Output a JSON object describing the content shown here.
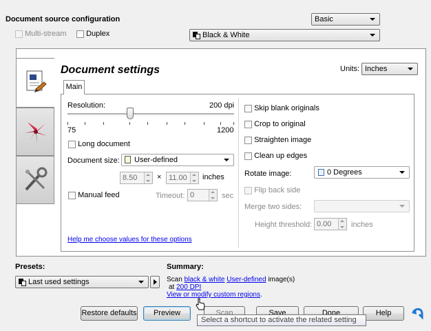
{
  "header": {
    "title": "Document source configuration",
    "mode_select": "Basic",
    "multistream_label": "Multi-stream",
    "duplex_label": "Duplex",
    "color_mode_select": "Black & White"
  },
  "panel": {
    "title": "Document settings",
    "units_label": "Units:",
    "units_select": "Inches",
    "tab_main": "Main",
    "resolution_label": "Resolution:",
    "resolution_value": "200 dpi",
    "slider_min": "75",
    "slider_max": "1200",
    "slider_level_dpi": 200,
    "long_document_label": "Long document",
    "document_size_label": "Document size:",
    "document_size_select": "User-defined",
    "width_value": "8.50",
    "times": "×",
    "height_value": "11.00",
    "size_unit": "inches",
    "manual_feed_label": "Manual feed",
    "timeout_label": "Timeout:",
    "timeout_value": "0",
    "timeout_unit": "sec",
    "help_link": "Help me choose values for these options",
    "skip_blank_label": "Skip blank originals",
    "crop_label": "Crop to original",
    "straighten_label": "Straighten image",
    "clean_edges_label": "Clean up edges",
    "rotate_label": "Rotate image:",
    "rotate_select": "0 Degrees",
    "flip_back_label": "Flip back side",
    "merge_label": "Merge two sides:",
    "merge_select": "",
    "height_threshold_label": "Height threshold:",
    "height_threshold_value": "0.00",
    "height_threshold_unit": "inches"
  },
  "presets": {
    "label": "Presets:",
    "select": "Last used settings"
  },
  "summary": {
    "label": "Summary:",
    "scan_prefix": "Scan ",
    "scan_link_color": "black & white",
    "scan_link_size": "User-defined",
    "scan_suffix": " image(s)",
    "at_prefix": "at ",
    "dpi_link": "200 DPI",
    "regions_link": "View or modify custom regions",
    "regions_suffix": "."
  },
  "buttons": {
    "restore": "Restore defaults",
    "preview": "Preview",
    "scan": "Scan",
    "save": "Save",
    "done": "Done",
    "help": "Help"
  },
  "tooltip": "Select a shortcut to activate the related setting",
  "colors": {
    "accent": "#3c7fb1",
    "link": "#0000ee",
    "panel_border": "#8e8f8f"
  }
}
